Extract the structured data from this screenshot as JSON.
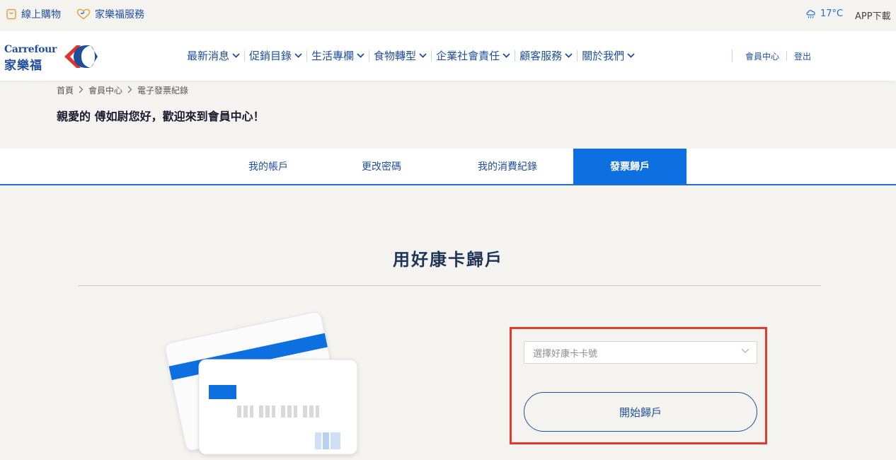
{
  "topbar": {
    "online_shop": "線上購物",
    "family_service": "家樂福服務",
    "temperature": "17°C",
    "app_download": "APP下載"
  },
  "brand": {
    "latin": "Carrefour",
    "chinese": "家樂福",
    "blue": "#1f4e9c",
    "red": "#e0342b"
  },
  "nav": {
    "items": [
      {
        "label": "最新消息"
      },
      {
        "label": "促銷目錄"
      },
      {
        "label": "生活專欄"
      },
      {
        "label": "食物轉型"
      },
      {
        "label": "企業社會責任"
      },
      {
        "label": "顧客服務"
      },
      {
        "label": "關於我們"
      }
    ],
    "member_center": "會員中心",
    "logout": "登出"
  },
  "breadcrumb": [
    "首頁",
    "會員中心",
    "電子發票紀錄"
  ],
  "greeting": "親愛的 傅如尉您好，歡迎來到會員中心！",
  "tabs": [
    {
      "label": "我的帳戶"
    },
    {
      "label": "更改密碼"
    },
    {
      "label": "我的消費紀錄"
    },
    {
      "label": "發票歸戶",
      "active": true
    }
  ],
  "section": {
    "title": "用好康卡歸戶"
  },
  "form": {
    "select_placeholder": "選擇好康卡卡號",
    "submit_label": "開始歸戶"
  },
  "colors": {
    "accent": "#0d6fe0",
    "highlight_border": "#e23b2e"
  }
}
